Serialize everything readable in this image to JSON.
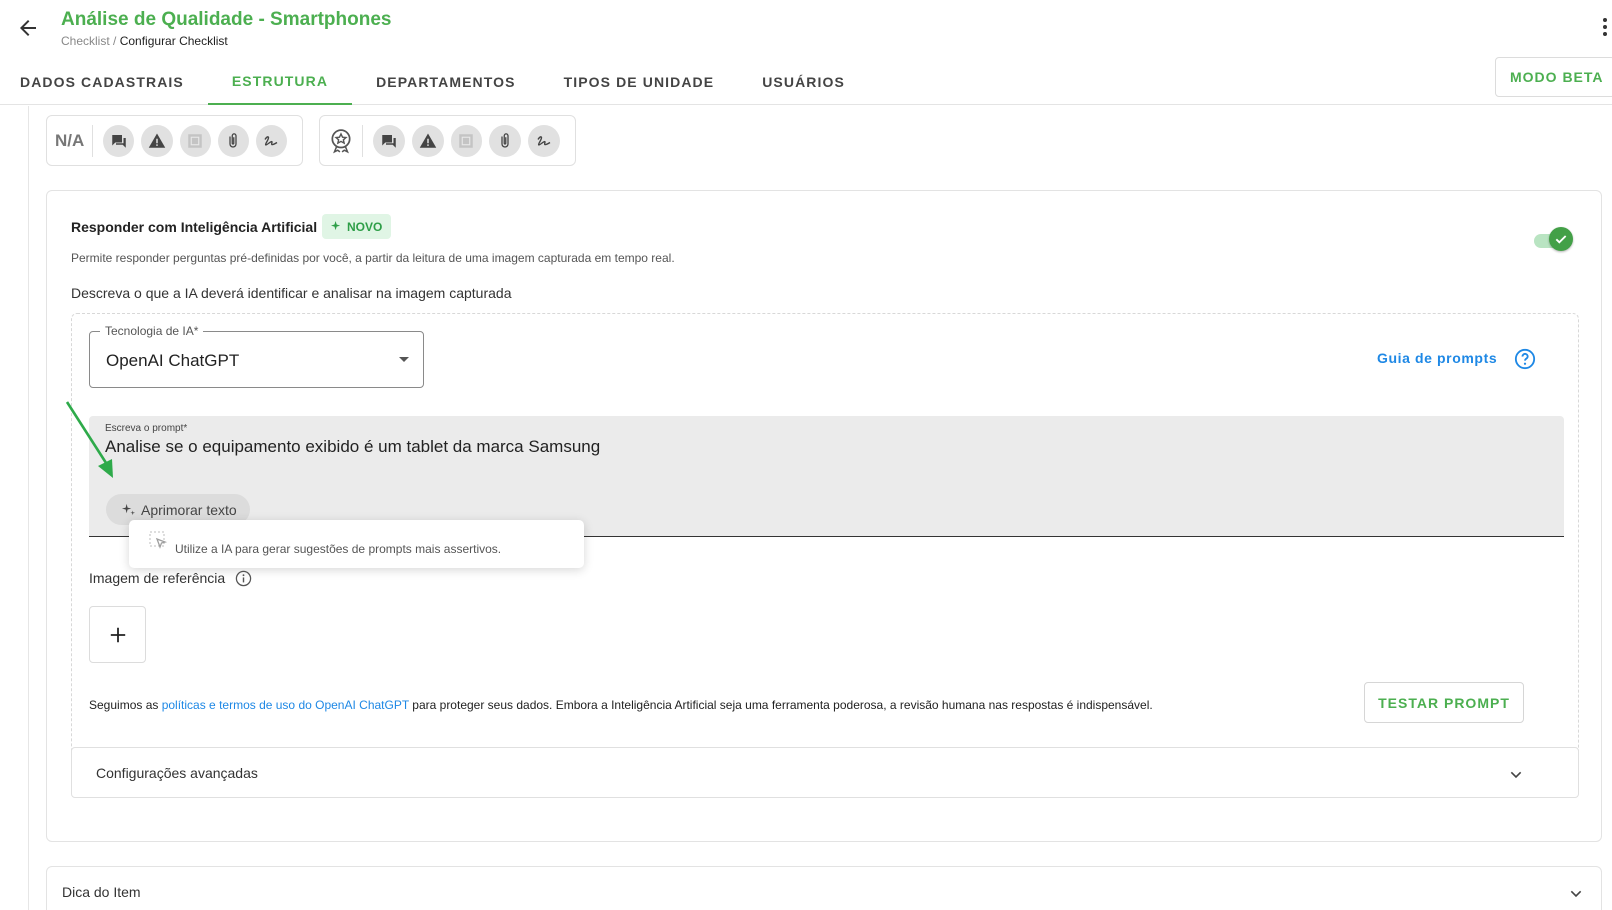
{
  "header": {
    "title": "Análise de Qualidade - Smartphones",
    "breadcrumb_root": "Checklist",
    "breadcrumb_sep": " / ",
    "breadcrumb_current": "Configurar Checklist",
    "beta_button": "MODO BETA",
    "tabs": [
      {
        "label": "DADOS CADASTRAIS",
        "active": false
      },
      {
        "label": "ESTRUTURA",
        "active": true
      },
      {
        "label": "DEPARTAMENTOS",
        "active": false
      },
      {
        "label": "TIPOS DE UNIDADE",
        "active": false
      },
      {
        "label": "USUÁRIOS",
        "active": false
      }
    ]
  },
  "response_options": {
    "na_label": "N/A",
    "group_1_icons": [
      "comment-icon",
      "warning-icon",
      "image-icon",
      "attachment-icon",
      "signature-icon"
    ],
    "group_2_icons": [
      "star-badge-icon",
      "comment-icon",
      "warning-icon",
      "image-icon",
      "attachment-icon",
      "signature-icon"
    ]
  },
  "ai": {
    "title": "Responder com Inteligência Artificial",
    "badge": "NOVO",
    "description": "Permite responder perguntas pré-definidas por você, a partir da leitura de uma imagem capturada em tempo real.",
    "enabled": true,
    "subtitle": "Descreva o que a IA deverá identificar e analisar na imagem capturada",
    "technology_label": "Tecnologia de IA*",
    "technology_value": "OpenAI ChatGPT",
    "guide_link": "Guia de prompts",
    "prompt_label": "Escreva o prompt*",
    "prompt_value": "Analise se o equipamento exibido é um tablet da marca Samsung",
    "improve_button": "Aprimorar texto",
    "tooltip": "Utilize a IA para gerar sugestões de prompts mais assertivos.",
    "reference_label": "Imagem de referência",
    "policy_prefix": "Seguimos as ",
    "policy_link": "políticas e termos de uso do OpenAI ChatGPT",
    "policy_suffix": " para proteger seus dados. Embora a Inteligência Artificial seja uma ferramenta poderosa, a revisão humana nas respostas é indispensável.",
    "test_button": "TESTAR PROMPT",
    "advanced_label": "Configurações avançadas"
  },
  "tip": {
    "label": "Dica do Item"
  },
  "colors": {
    "brand_green": "#4caf50",
    "link_blue": "#1e88e5",
    "badge_bg": "#e0f5e5"
  }
}
